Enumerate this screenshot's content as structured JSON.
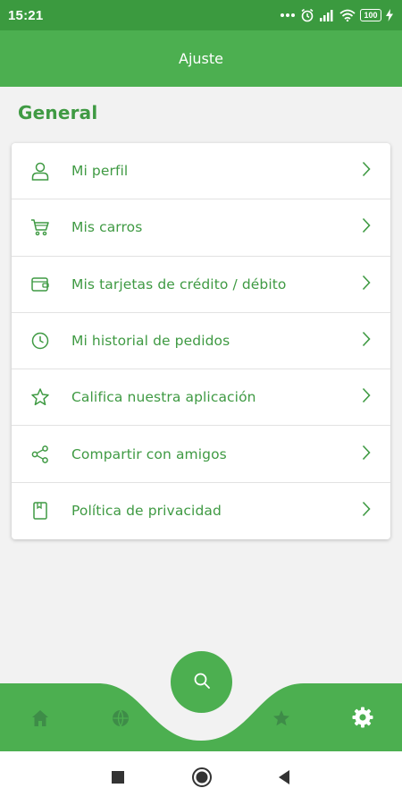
{
  "status_bar": {
    "time": "15:21",
    "battery": "100",
    "icons": [
      "dots-icon",
      "alarm-icon",
      "signal-icon",
      "wifi-icon",
      "battery-icon",
      "charging-icon"
    ]
  },
  "app_bar": {
    "title": "Ajuste"
  },
  "section": {
    "title": "General"
  },
  "menu": {
    "items": [
      {
        "label": "Mi perfil",
        "icon": "user-icon"
      },
      {
        "label": "Mis carros",
        "icon": "cart-icon"
      },
      {
        "label": "Mis tarjetas de crédito / débito",
        "icon": "wallet-icon"
      },
      {
        "label": "Mi historial de pedidos",
        "icon": "clock-icon"
      },
      {
        "label": "Califica nuestra aplicación",
        "icon": "star-icon"
      },
      {
        "label": "Compartir con amigos",
        "icon": "share-icon"
      },
      {
        "label": "Política de privacidad",
        "icon": "document-icon"
      }
    ]
  },
  "bottom_nav": {
    "items": [
      "home-icon",
      "globe-icon",
      "search-icon",
      "favorites-icon",
      "settings-icon"
    ],
    "active": "settings-icon"
  },
  "colors": {
    "primary": "#4caf50",
    "primary_dark": "#3b9a3f",
    "text_green": "#3f9a43",
    "background": "#f2f2f2",
    "nav_inactive": "#3e8c48"
  }
}
